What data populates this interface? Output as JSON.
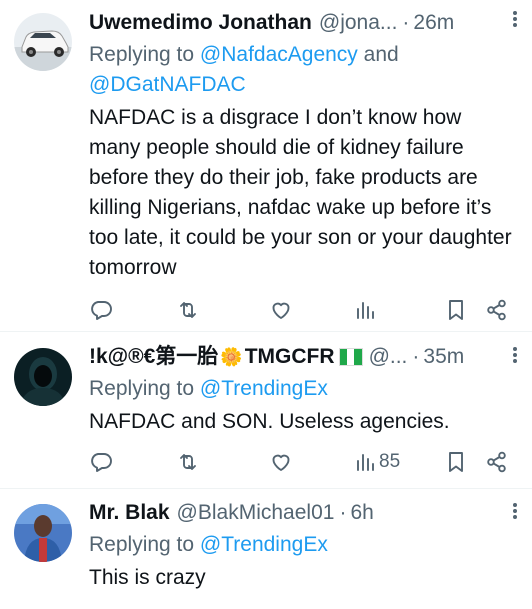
{
  "tweets": [
    {
      "name": "Uwemedimo Jonathan",
      "handle": "@jona...",
      "separator": "·",
      "time": "26m",
      "replying_prefix": "Replying to ",
      "replying_handles": [
        "@NafdacAgency",
        "@DGatNAFDAC"
      ],
      "replying_joiner": " and ",
      "body": "NAFDAC is a disgrace I don’t know how many people should die of kidney failure before they do their job, fake products are killing Nigerians, nafdac wake up before it’s too late, it could be your son or your daughter tomorrow",
      "views": ""
    },
    {
      "name_part1": "!k@®€第一胎",
      "name_flower": "🌼",
      "name_part2": "TMGCFR",
      "handle": "@...",
      "separator": "·",
      "time": "35m",
      "replying_prefix": "Replying to ",
      "replying_handles": [
        "@TrendingEx"
      ],
      "body": "NAFDAC and SON. Useless agencies.",
      "views": "85"
    },
    {
      "name": "Mr. Blak",
      "handle": "@BlakMichael01",
      "separator": "·",
      "time": "6h",
      "replying_prefix": "Replying to ",
      "replying_handles": [
        "@TrendingEx"
      ],
      "body": "This is crazy"
    }
  ],
  "icons": {
    "reply": "reply-icon",
    "retweet": "retweet-icon",
    "like": "like-icon",
    "views": "views-icon",
    "bookmark": "bookmark-icon",
    "share": "share-icon",
    "more": "more-icon"
  },
  "colors": {
    "link": "#1d9bf0",
    "secondary": "#536471",
    "text": "#0f1419",
    "divider": "#eff3f4"
  }
}
